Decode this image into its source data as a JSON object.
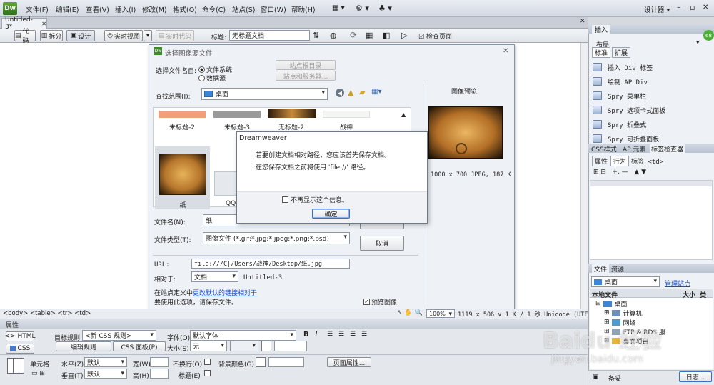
{
  "app": {
    "logo": "Dw",
    "menu": [
      "文件(F)",
      "编辑(E)",
      "查看(V)",
      "插入(I)",
      "修改(M)",
      "格式(O)",
      "命令(C)",
      "站点(S)",
      "窗口(W)",
      "帮助(H)"
    ],
    "workspace": "设计器",
    "window_controls": [
      "–",
      "▫",
      "✕"
    ]
  },
  "doc": {
    "tab": "Untitled-3*",
    "path_hint": "",
    "views": {
      "code": "代码",
      "split": "拆分",
      "design": "设计",
      "live_view": "实时视图",
      "live_code": "实时代码"
    },
    "title_label": "标题:",
    "title_value": "无标题文档",
    "check_page": "检查页面"
  },
  "file_dialog": {
    "title": "选择图像源文件",
    "source_label": "选择文件名自:",
    "radio_fs": "文件系统",
    "radio_ds": "数据源",
    "site_root_btn": "站点根目录",
    "site_server_btn": "站点和服务器...",
    "look_in_label": "查找范围(I):",
    "look_in_value": "桌面",
    "thumbnails_row1": [
      "未标题-2",
      "未标题-3",
      "无标题-2",
      "战神"
    ],
    "thumbnails_row2": [
      "纸",
      "QQ"
    ],
    "filename_label": "文件名(N):",
    "filename_value": "纸",
    "filetype_label": "文件类型(T):",
    "filetype_value": "图像文件 (*.gif;*.jpg;*.jpeg;*.png;*.psd)",
    "ok_btn": "",
    "cancel_btn": "取消",
    "url_label": "URL:",
    "url_value": "file:///C|/Users/战神/Desktop/纸.jpg",
    "relative_label": "相对于:",
    "relative_value": "文档",
    "relative_doc": "Untitled-3",
    "site_def_prefix": "在站点定义中",
    "site_def_link": "更改默认的链接相对于",
    "save_hint": "要使用此选项，请保存文件。",
    "preview_title": "图像预览",
    "preview_info": "1000 x 700 JPEG, 187 K",
    "preview_checkbox": "预览图像"
  },
  "alert": {
    "title": "Dreamweaver",
    "line1": "若要创建文档相对路径，您应该首先保存文档。",
    "line2": "在您保存文档之前将使用 'file://' 路径。",
    "checkbox": "不再显示这个信息。",
    "ok": "确定"
  },
  "status_bar": {
    "tags": "<body> <table> <tr> <td>",
    "zoom": "100%",
    "size": "1119 x 506 ∨ 1 K / 1 秒 Unicode (UTF-8)"
  },
  "properties": {
    "header": "属性",
    "html_btn": "HTML",
    "css_btn": "CSS",
    "target_rule_label": "目标规则",
    "target_rule_value": "<新 CSS 规则>",
    "edit_rule": "编辑规则",
    "css_panel": "CSS 面板(P)",
    "font_label": "字体(O)",
    "font_value": "默认字体",
    "size_label": "大小(S)",
    "size_value": "无",
    "cell_label": "单元格",
    "horz_label": "水平(Z)",
    "horz_value": "默认",
    "vert_label": "垂直(T)",
    "vert_value": "默认",
    "width_label": "宽(W)",
    "height_label": "高(H)",
    "nowrap_label": "不换行(O)",
    "header_label": "标题(E)",
    "bg_label": "背景颜色(G)",
    "page_props": "页面属性..."
  },
  "insert_panel": {
    "tab": "插入",
    "category": "布局",
    "tabs": [
      "标准",
      "扩展"
    ],
    "items": [
      "插入 Div 标签",
      "绘制 AP Div",
      "Spry 菜单栏",
      "Spry 选项卡式面板",
      "Spry 折叠式",
      "Spry 可折叠面板"
    ]
  },
  "css_panel": {
    "tabs": [
      "CSS样式",
      "AP 元素",
      "标签检查器"
    ],
    "subtabs": [
      "属性",
      "行为"
    ],
    "tag": "标签 <td>"
  },
  "files_panel": {
    "tabs": [
      "文件",
      "资源"
    ],
    "location": "桌面",
    "manage": "管理站点",
    "col_local": "本地文件",
    "col_size": "大小",
    "col_type": "类",
    "tree": [
      "桌面",
      "计算机",
      "网络",
      "FTP & RDS 服",
      "桌面项目"
    ],
    "ready": "备妥",
    "log": "日志..."
  },
  "watermark": {
    "line1": "Baidu 经验",
    "line2": "jingyan.baidu.com"
  }
}
